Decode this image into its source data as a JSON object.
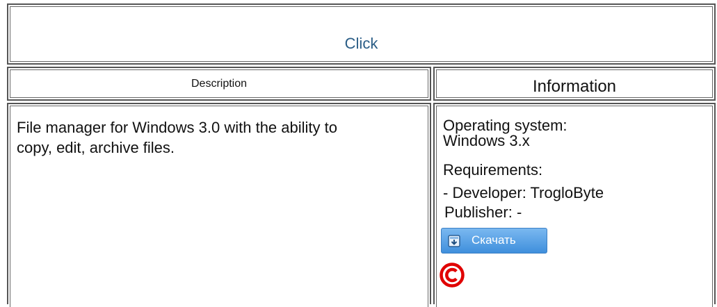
{
  "title_link": "Click",
  "table": {
    "description_header": "Description",
    "information_header": "Information",
    "description_text": "File manager for Windows 3.0 with the ability to copy, edit, archive files.",
    "info": {
      "os_label": "Operating system:",
      "os_value": "Windows 3.x",
      "requirements_label": "Requirements:",
      "developer_line": "- Developer: TrogloByte",
      "publisher_line": "Publisher: -"
    }
  },
  "download_button": {
    "label": "Скачать",
    "icon": "download-icon",
    "color": "#4a98e0"
  },
  "copyright": {
    "icon": "copyright-icon",
    "color": "#e00000"
  }
}
